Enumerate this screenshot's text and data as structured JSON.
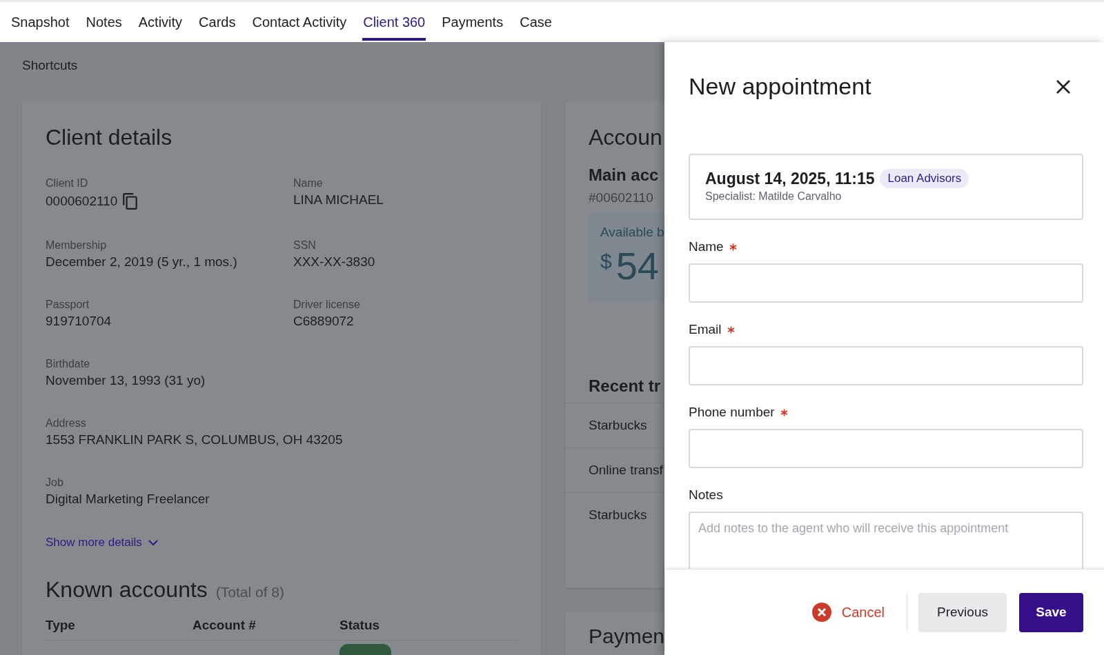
{
  "tabs": [
    {
      "label": "Snapshot",
      "selected": false
    },
    {
      "label": "Notes",
      "selected": false
    },
    {
      "label": "Activity",
      "selected": false
    },
    {
      "label": "Cards",
      "selected": false
    },
    {
      "label": "Contact Activity",
      "selected": false
    },
    {
      "label": "Client 360",
      "selected": true
    },
    {
      "label": "Payments",
      "selected": false
    },
    {
      "label": "Case",
      "selected": false
    }
  ],
  "shortcuts": {
    "title": "Shortcuts"
  },
  "client_details": {
    "title": "Client details",
    "rows": [
      [
        {
          "label": "Client ID",
          "value": "0000602110",
          "copyable": true
        },
        {
          "label": "Name",
          "value": "LINA MICHAEL",
          "copyable": false
        }
      ],
      [
        {
          "label": "Membership",
          "value": "December 2, 2019 (5 yr., 1 mos.)",
          "copyable": false
        },
        {
          "label": "SSN",
          "value": "XXX-XX-3830",
          "copyable": false
        }
      ],
      [
        {
          "label": "Passport",
          "value": "919710704",
          "copyable": false
        },
        {
          "label": "Driver license",
          "value": "C6889072",
          "copyable": false
        }
      ],
      [
        {
          "label": "Birthdate",
          "value": "November 13, 1993 (31 yo)",
          "copyable": false
        }
      ],
      [
        {
          "label": "Address",
          "value": "1553 FRANKLIN PARK S, COLUMBUS, OH 43205",
          "copyable": false
        }
      ],
      [
        {
          "label": "Job",
          "value": "Digital Marketing Freelancer",
          "copyable": false
        }
      ]
    ],
    "show_more": "Show more details",
    "known_accounts": {
      "title": "Known accounts",
      "total": "(Total of 8)",
      "columns": [
        "Type",
        "Account #",
        "Status"
      ]
    }
  },
  "accounts_card": {
    "title": "Accoun",
    "main_account": "Main acc",
    "account_number": "#00602110",
    "available_label": "Available b",
    "currency": "$",
    "balance": "54"
  },
  "recent_transactions": {
    "title": "Recent tr",
    "rows": [
      "Starbucks",
      "Online transf",
      "Starbucks"
    ]
  },
  "payments_card": {
    "title": "Paymen"
  },
  "drawer": {
    "title": "New appointment",
    "appointment": {
      "datetime": "August 14, 2025, 11:15",
      "tag": "Loan Advisors",
      "specialist": "Specialist: Matilde Carvalho"
    },
    "fields": [
      {
        "label": "Name",
        "required": true,
        "kind": "input"
      },
      {
        "label": "Email",
        "required": true,
        "kind": "input"
      },
      {
        "label": "Phone number",
        "required": true,
        "kind": "input"
      },
      {
        "label": "Notes",
        "required": false,
        "kind": "textarea",
        "placeholder": "Add notes to the agent who will receive this appointment"
      }
    ],
    "buttons": [
      {
        "label": "Cancel",
        "kind": "cancel"
      },
      {
        "label": "Previous",
        "kind": "secondary"
      },
      {
        "label": "Save",
        "kind": "primary"
      }
    ]
  }
}
